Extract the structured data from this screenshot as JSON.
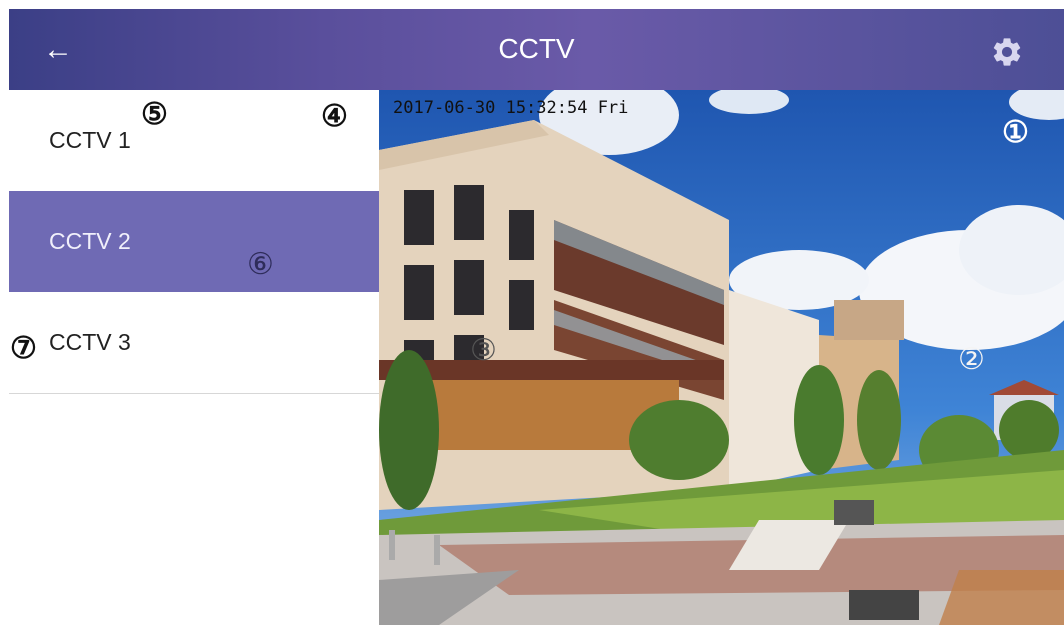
{
  "header": {
    "title": "CCTV",
    "back_icon": "arrow-left-icon",
    "settings_icon": "gear-icon",
    "gradient": [
      "#3b3f86",
      "#6a5aa8"
    ]
  },
  "sidebar": {
    "items": [
      {
        "label": "CCTV 1",
        "active": false
      },
      {
        "label": "CCTV 2",
        "active": true
      },
      {
        "label": "CCTV 3",
        "active": false
      }
    ],
    "active_color": "#6f6ab4"
  },
  "feed": {
    "timestamp": "2017-06-30 15:32:54 Fri"
  },
  "markers": [
    "①",
    "②",
    "③",
    "④",
    "⑤",
    "⑥",
    "⑦"
  ]
}
